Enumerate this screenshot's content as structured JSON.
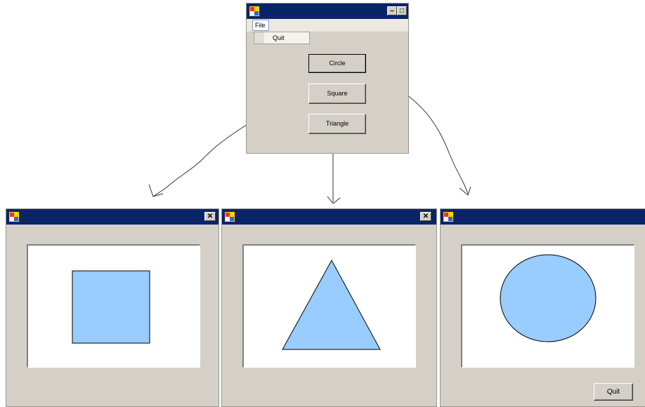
{
  "main_window": {
    "menu_file_label": "File",
    "menu_quit_label": "Quit",
    "buttons": {
      "circle": "Circle",
      "square": "Square",
      "triangle": "Triangle"
    }
  },
  "circle_window": {
    "quit_label": "Quit"
  },
  "colors": {
    "titlebar": "#0a246a",
    "face": "#d4d0c8",
    "shape_fill": "#99ccff",
    "canvas": "#ffffff"
  }
}
